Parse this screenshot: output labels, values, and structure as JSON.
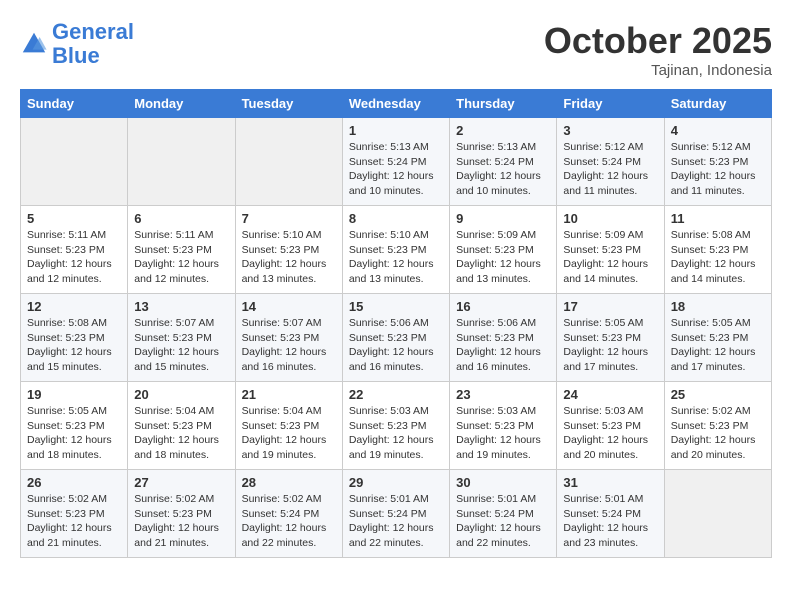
{
  "header": {
    "logo_text_general": "General",
    "logo_text_blue": "Blue",
    "month": "October 2025",
    "location": "Tajinan, Indonesia"
  },
  "calendar": {
    "days_of_week": [
      "Sunday",
      "Monday",
      "Tuesday",
      "Wednesday",
      "Thursday",
      "Friday",
      "Saturday"
    ],
    "weeks": [
      [
        {
          "day": "",
          "sunrise": "",
          "sunset": "",
          "daylight": ""
        },
        {
          "day": "",
          "sunrise": "",
          "sunset": "",
          "daylight": ""
        },
        {
          "day": "",
          "sunrise": "",
          "sunset": "",
          "daylight": ""
        },
        {
          "day": "1",
          "sunrise": "Sunrise: 5:13 AM",
          "sunset": "Sunset: 5:24 PM",
          "daylight": "Daylight: 12 hours and 10 minutes."
        },
        {
          "day": "2",
          "sunrise": "Sunrise: 5:13 AM",
          "sunset": "Sunset: 5:24 PM",
          "daylight": "Daylight: 12 hours and 10 minutes."
        },
        {
          "day": "3",
          "sunrise": "Sunrise: 5:12 AM",
          "sunset": "Sunset: 5:24 PM",
          "daylight": "Daylight: 12 hours and 11 minutes."
        },
        {
          "day": "4",
          "sunrise": "Sunrise: 5:12 AM",
          "sunset": "Sunset: 5:23 PM",
          "daylight": "Daylight: 12 hours and 11 minutes."
        }
      ],
      [
        {
          "day": "5",
          "sunrise": "Sunrise: 5:11 AM",
          "sunset": "Sunset: 5:23 PM",
          "daylight": "Daylight: 12 hours and 12 minutes."
        },
        {
          "day": "6",
          "sunrise": "Sunrise: 5:11 AM",
          "sunset": "Sunset: 5:23 PM",
          "daylight": "Daylight: 12 hours and 12 minutes."
        },
        {
          "day": "7",
          "sunrise": "Sunrise: 5:10 AM",
          "sunset": "Sunset: 5:23 PM",
          "daylight": "Daylight: 12 hours and 13 minutes."
        },
        {
          "day": "8",
          "sunrise": "Sunrise: 5:10 AM",
          "sunset": "Sunset: 5:23 PM",
          "daylight": "Daylight: 12 hours and 13 minutes."
        },
        {
          "day": "9",
          "sunrise": "Sunrise: 5:09 AM",
          "sunset": "Sunset: 5:23 PM",
          "daylight": "Daylight: 12 hours and 13 minutes."
        },
        {
          "day": "10",
          "sunrise": "Sunrise: 5:09 AM",
          "sunset": "Sunset: 5:23 PM",
          "daylight": "Daylight: 12 hours and 14 minutes."
        },
        {
          "day": "11",
          "sunrise": "Sunrise: 5:08 AM",
          "sunset": "Sunset: 5:23 PM",
          "daylight": "Daylight: 12 hours and 14 minutes."
        }
      ],
      [
        {
          "day": "12",
          "sunrise": "Sunrise: 5:08 AM",
          "sunset": "Sunset: 5:23 PM",
          "daylight": "Daylight: 12 hours and 15 minutes."
        },
        {
          "day": "13",
          "sunrise": "Sunrise: 5:07 AM",
          "sunset": "Sunset: 5:23 PM",
          "daylight": "Daylight: 12 hours and 15 minutes."
        },
        {
          "day": "14",
          "sunrise": "Sunrise: 5:07 AM",
          "sunset": "Sunset: 5:23 PM",
          "daylight": "Daylight: 12 hours and 16 minutes."
        },
        {
          "day": "15",
          "sunrise": "Sunrise: 5:06 AM",
          "sunset": "Sunset: 5:23 PM",
          "daylight": "Daylight: 12 hours and 16 minutes."
        },
        {
          "day": "16",
          "sunrise": "Sunrise: 5:06 AM",
          "sunset": "Sunset: 5:23 PM",
          "daylight": "Daylight: 12 hours and 16 minutes."
        },
        {
          "day": "17",
          "sunrise": "Sunrise: 5:05 AM",
          "sunset": "Sunset: 5:23 PM",
          "daylight": "Daylight: 12 hours and 17 minutes."
        },
        {
          "day": "18",
          "sunrise": "Sunrise: 5:05 AM",
          "sunset": "Sunset: 5:23 PM",
          "daylight": "Daylight: 12 hours and 17 minutes."
        }
      ],
      [
        {
          "day": "19",
          "sunrise": "Sunrise: 5:05 AM",
          "sunset": "Sunset: 5:23 PM",
          "daylight": "Daylight: 12 hours and 18 minutes."
        },
        {
          "day": "20",
          "sunrise": "Sunrise: 5:04 AM",
          "sunset": "Sunset: 5:23 PM",
          "daylight": "Daylight: 12 hours and 18 minutes."
        },
        {
          "day": "21",
          "sunrise": "Sunrise: 5:04 AM",
          "sunset": "Sunset: 5:23 PM",
          "daylight": "Daylight: 12 hours and 19 minutes."
        },
        {
          "day": "22",
          "sunrise": "Sunrise: 5:03 AM",
          "sunset": "Sunset: 5:23 PM",
          "daylight": "Daylight: 12 hours and 19 minutes."
        },
        {
          "day": "23",
          "sunrise": "Sunrise: 5:03 AM",
          "sunset": "Sunset: 5:23 PM",
          "daylight": "Daylight: 12 hours and 19 minutes."
        },
        {
          "day": "24",
          "sunrise": "Sunrise: 5:03 AM",
          "sunset": "Sunset: 5:23 PM",
          "daylight": "Daylight: 12 hours and 20 minutes."
        },
        {
          "day": "25",
          "sunrise": "Sunrise: 5:02 AM",
          "sunset": "Sunset: 5:23 PM",
          "daylight": "Daylight: 12 hours and 20 minutes."
        }
      ],
      [
        {
          "day": "26",
          "sunrise": "Sunrise: 5:02 AM",
          "sunset": "Sunset: 5:23 PM",
          "daylight": "Daylight: 12 hours and 21 minutes."
        },
        {
          "day": "27",
          "sunrise": "Sunrise: 5:02 AM",
          "sunset": "Sunset: 5:23 PM",
          "daylight": "Daylight: 12 hours and 21 minutes."
        },
        {
          "day": "28",
          "sunrise": "Sunrise: 5:02 AM",
          "sunset": "Sunset: 5:24 PM",
          "daylight": "Daylight: 12 hours and 22 minutes."
        },
        {
          "day": "29",
          "sunrise": "Sunrise: 5:01 AM",
          "sunset": "Sunset: 5:24 PM",
          "daylight": "Daylight: 12 hours and 22 minutes."
        },
        {
          "day": "30",
          "sunrise": "Sunrise: 5:01 AM",
          "sunset": "Sunset: 5:24 PM",
          "daylight": "Daylight: 12 hours and 22 minutes."
        },
        {
          "day": "31",
          "sunrise": "Sunrise: 5:01 AM",
          "sunset": "Sunset: 5:24 PM",
          "daylight": "Daylight: 12 hours and 23 minutes."
        },
        {
          "day": "",
          "sunrise": "",
          "sunset": "",
          "daylight": ""
        }
      ]
    ]
  }
}
